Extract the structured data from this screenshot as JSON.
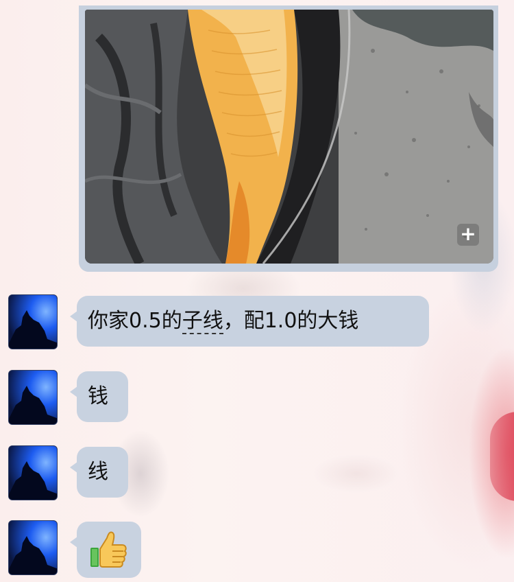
{
  "conversation": {
    "photo": {
      "icon": "zoom-plus-icon",
      "zoom_glyph": "+"
    },
    "messages": [
      {
        "text_parts": [
          "你家0.5的",
          "子线",
          "，配1.0的大钱"
        ]
      },
      {
        "text": "钱"
      },
      {
        "text": "线"
      },
      {
        "emoji": "thumbs-up-icon"
      }
    ]
  },
  "colors": {
    "bubble": "#c8d2e0",
    "photo_frame": "#c6d0de",
    "fish": "#f2b24c",
    "avatar_blue": "#1d5cf0"
  }
}
